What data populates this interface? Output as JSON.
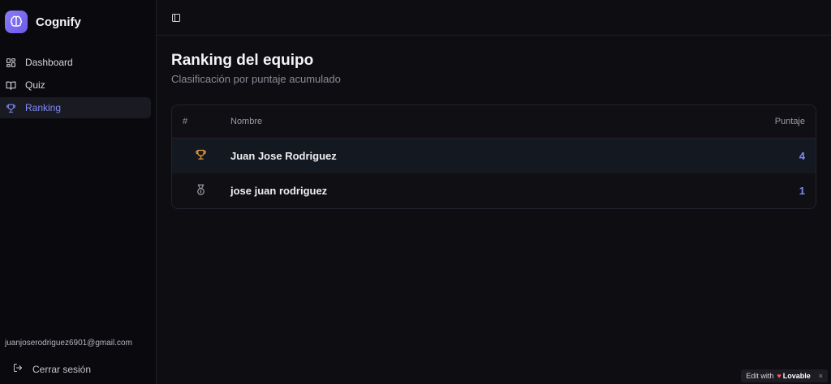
{
  "brand": {
    "name": "Cognify",
    "logo_icon": "brain-icon"
  },
  "sidebar": {
    "items": [
      {
        "label": "Dashboard",
        "icon": "dashboard-grid-icon",
        "active": false
      },
      {
        "label": "Quiz",
        "icon": "book-open-icon",
        "active": false
      },
      {
        "label": "Ranking",
        "icon": "trophy-icon",
        "active": true
      }
    ],
    "user_email": "juanjoserodriguez6901@gmail.com",
    "logout_label": "Cerrar sesión"
  },
  "page": {
    "title": "Ranking del equipo",
    "subtitle": "Clasificación por puntaje acumulado"
  },
  "table": {
    "headers": {
      "rank": "#",
      "name": "Nombre",
      "score": "Puntaje"
    },
    "rows": [
      {
        "rank_icon": "trophy-icon",
        "name": "Juan Jose Rodriguez",
        "score": "4"
      },
      {
        "rank_icon": "medal-icon",
        "name": "jose juan rodriguez",
        "score": "1"
      }
    ]
  },
  "badge": {
    "prefix": "Edit with",
    "brand": "Lovable",
    "close": "×"
  },
  "colors": {
    "accent": "#7f8cf8",
    "brand_gradient_start": "#8b7cf6",
    "trophy": "#f0a030"
  }
}
